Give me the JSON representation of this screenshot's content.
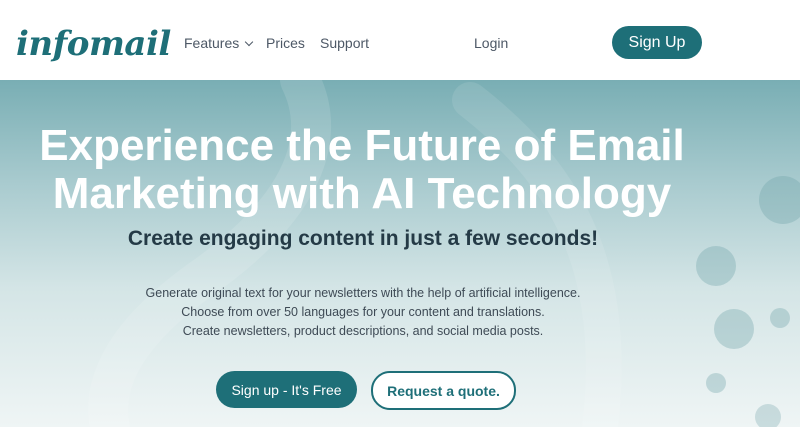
{
  "brand": {
    "logo_text": "infomail"
  },
  "nav": {
    "features_label": "Features",
    "prices_label": "Prices",
    "support_label": "Support",
    "login_label": "Login",
    "signup_label": "Sign Up"
  },
  "hero": {
    "headline_line1": "Experience the Future of Email",
    "headline_line2": "Marketing with AI Technology",
    "subheadline": "Create engaging content in just a few seconds!",
    "description_lines": [
      "Generate original text for your newsletters with the help of artificial intelligence.",
      "Choose from over 50 languages for your content and translations.",
      "Create newsletters, product descriptions, and social media posts."
    ],
    "primary_button_label": "Sign up - It's Free",
    "secondary_button_label": "Request a quote."
  },
  "colors": {
    "brand": "#1e6f78",
    "hero_top": "#79aeb4",
    "hero_bottom": "#eff5f5",
    "subheadline": "#243a46"
  }
}
